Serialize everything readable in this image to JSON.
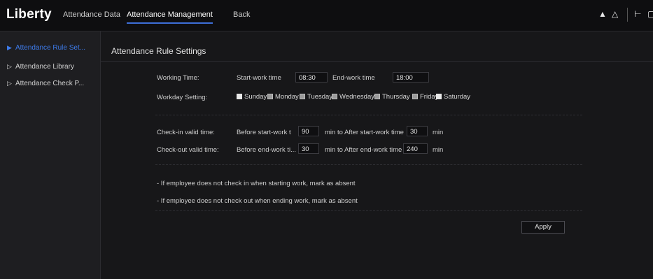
{
  "app": {
    "logo": "Liberty"
  },
  "nav": {
    "attendance_data": "Attendance Data",
    "attendance_management": "Attendance Management",
    "back": "Back"
  },
  "header_icons": [
    "bell-icon",
    "user-icon",
    "logout-icon",
    "fullscreen-icon"
  ],
  "sidebar": {
    "items": [
      {
        "label": "Attendance Rule Set...",
        "active": true
      },
      {
        "label": "Attendance Library",
        "active": false
      },
      {
        "label": "Attendance Check P...",
        "active": false
      }
    ]
  },
  "page": {
    "title": "Attendance Rule Settings"
  },
  "working_time": {
    "label": "Working Time:",
    "start_label": "Start-work time",
    "start_value": "08:30",
    "end_label": "End-work time",
    "end_value": "18:00"
  },
  "workday": {
    "label": "Workday Setting:",
    "days": [
      {
        "label": "Sunday",
        "checked": false
      },
      {
        "label": "Monday",
        "checked": true
      },
      {
        "label": "Tuesday",
        "checked": true
      },
      {
        "label": "Wednesday",
        "checked": true
      },
      {
        "label": "Thursday",
        "checked": true
      },
      {
        "label": "Friday",
        "checked": true
      },
      {
        "label": "Saturday",
        "checked": false
      }
    ]
  },
  "checkin": {
    "label": "Check-in valid time:",
    "before_label": "Before start-work t",
    "before_value": "90",
    "after_label": "min to After start-work time",
    "after_value": "30",
    "unit": "min"
  },
  "checkout": {
    "label": "Check-out valid time:",
    "before_label": "Before end-work ti...",
    "before_value": "30",
    "after_label": "min to After end-work time",
    "after_value": "240",
    "unit": "min"
  },
  "notes": {
    "absent_checkin": "- If employee does not check in when starting work, mark as absent",
    "absent_checkout": "- If employee does not check out when ending work, mark as absent"
  },
  "actions": {
    "apply": "Apply"
  },
  "colors": {
    "accent": "#3d6fd8",
    "background": "#171719",
    "sidebar": "#1e1e21"
  }
}
